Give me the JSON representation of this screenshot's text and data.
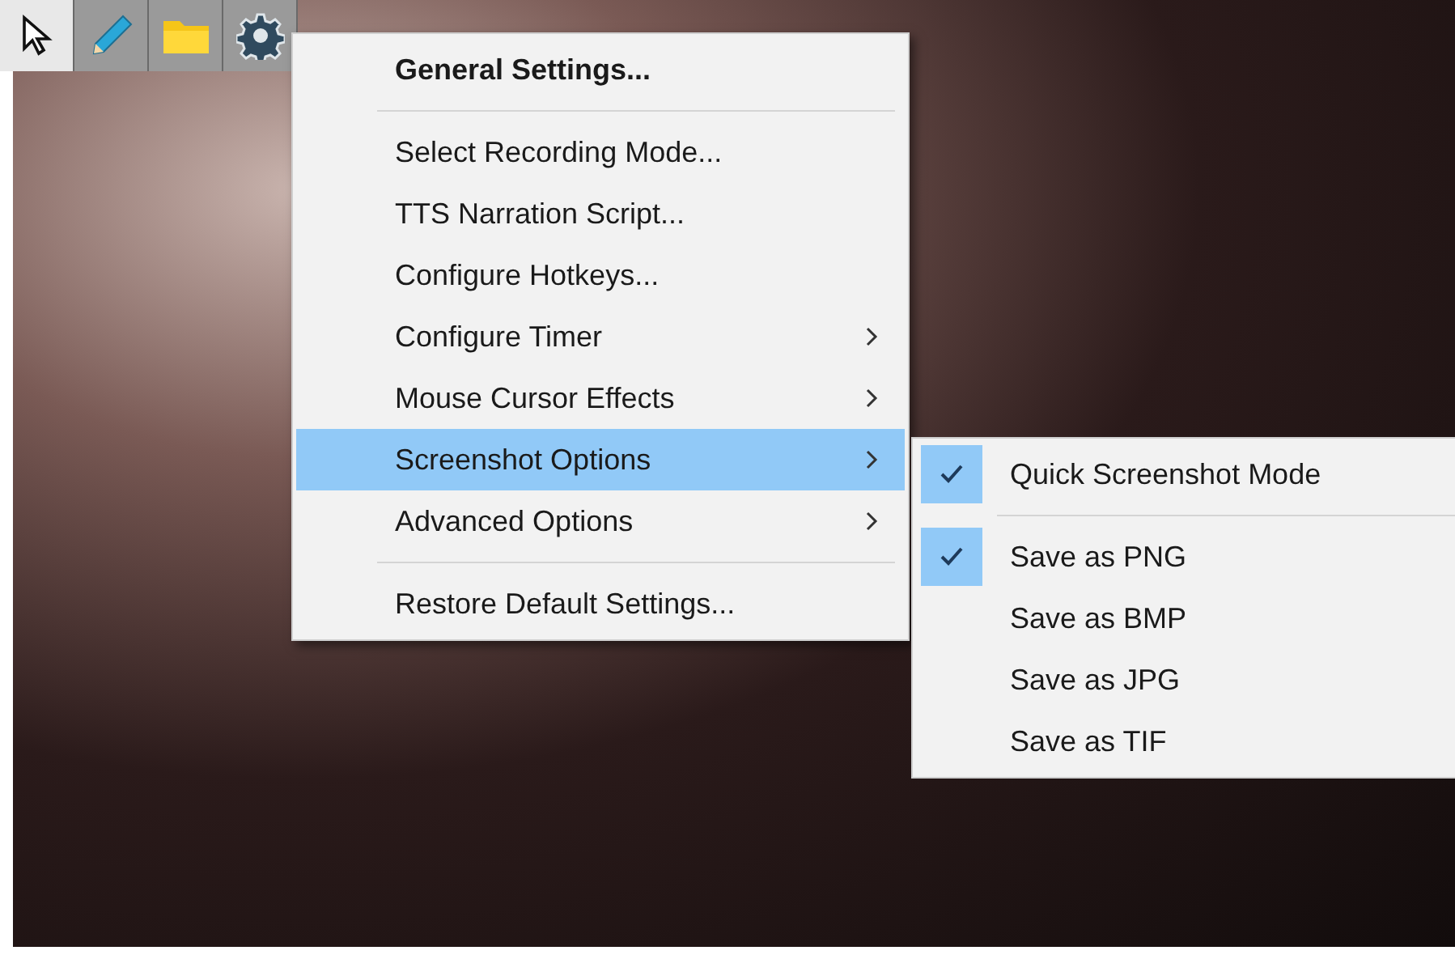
{
  "toolbar": [
    {
      "kind": "cursor"
    },
    {
      "kind": "pencil"
    },
    {
      "kind": "folder"
    },
    {
      "kind": "gear"
    }
  ],
  "menu": {
    "items": [
      {
        "kind": "heading",
        "label": "General Settings...",
        "submenu": false,
        "selected": false
      },
      {
        "kind": "separator"
      },
      {
        "kind": "item",
        "label": "Select Recording Mode...",
        "submenu": false,
        "selected": false
      },
      {
        "kind": "item",
        "label": "TTS Narration Script...",
        "submenu": false,
        "selected": false
      },
      {
        "kind": "item",
        "label": "Configure Hotkeys...",
        "submenu": false,
        "selected": false
      },
      {
        "kind": "item",
        "label": "Configure Timer",
        "submenu": true,
        "selected": false
      },
      {
        "kind": "item",
        "label": "Mouse Cursor Effects",
        "submenu": true,
        "selected": false
      },
      {
        "kind": "item",
        "label": "Screenshot Options",
        "submenu": true,
        "selected": true
      },
      {
        "kind": "item",
        "label": "Advanced Options",
        "submenu": true,
        "selected": false
      },
      {
        "kind": "separator"
      },
      {
        "kind": "item",
        "label": "Restore Default Settings...",
        "submenu": false,
        "selected": false
      }
    ]
  },
  "submenu": {
    "items": [
      {
        "kind": "item",
        "label": "Quick Screenshot Mode",
        "checked": true
      },
      {
        "kind": "separator"
      },
      {
        "kind": "item",
        "label": "Save as PNG",
        "checked": true
      },
      {
        "kind": "item",
        "label": "Save as BMP",
        "checked": false
      },
      {
        "kind": "item",
        "label": "Save as JPG",
        "checked": false
      },
      {
        "kind": "item",
        "label": "Save as TIF",
        "checked": false
      }
    ]
  }
}
